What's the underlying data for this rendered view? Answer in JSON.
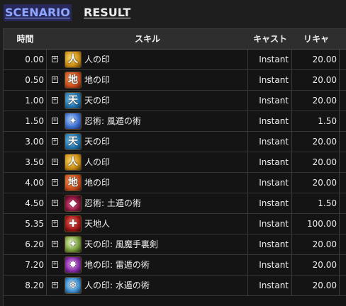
{
  "tabs": [
    {
      "label": "SCENARIO",
      "active": true
    },
    {
      "label": "RESULT",
      "active": false
    }
  ],
  "table": {
    "headers": {
      "time": "時間",
      "skill": "スキル",
      "cast": "キャスト",
      "recast": "リキャ"
    },
    "rows": [
      {
        "time": "0.00",
        "icon": "jin-seal-icon",
        "skill": "人の印",
        "cast": "Instant",
        "recast": "20.00"
      },
      {
        "time": "0.50",
        "icon": "chi-seal-icon",
        "skill": "地の印",
        "cast": "Instant",
        "recast": "20.00"
      },
      {
        "time": "1.00",
        "icon": "ten-seal-icon",
        "skill": "天の印",
        "cast": "Instant",
        "recast": "20.00"
      },
      {
        "time": "1.50",
        "icon": "fuma-shuriken-icon",
        "skill": "忍術: 風遁の術",
        "cast": "Instant",
        "recast": "1.50"
      },
      {
        "time": "3.00",
        "icon": "ten-seal-icon",
        "skill": "天の印",
        "cast": "Instant",
        "recast": "20.00"
      },
      {
        "time": "3.50",
        "icon": "jin-seal-icon",
        "skill": "人の印",
        "cast": "Instant",
        "recast": "20.00"
      },
      {
        "time": "4.00",
        "icon": "chi-seal-icon",
        "skill": "地の印",
        "cast": "Instant",
        "recast": "20.00"
      },
      {
        "time": "4.50",
        "icon": "doton-icon",
        "skill": "忍術: 土遁の術",
        "cast": "Instant",
        "recast": "1.50"
      },
      {
        "time": "5.35",
        "icon": "ten-chi-jin-icon",
        "skill": "天地人",
        "cast": "Instant",
        "recast": "100.00"
      },
      {
        "time": "6.20",
        "icon": "fuma-shuriken-tcj-icon",
        "skill": "天の印: 風魔手裏剣",
        "cast": "Instant",
        "recast": "20.00"
      },
      {
        "time": "7.20",
        "icon": "raiton-icon",
        "skill": "地の印: 雷遁の術",
        "cast": "Instant",
        "recast": "20.00"
      },
      {
        "time": "8.20",
        "icon": "suiton-icon",
        "skill": "人の印: 水遁の術",
        "cast": "Instant",
        "recast": "20.00"
      }
    ]
  }
}
